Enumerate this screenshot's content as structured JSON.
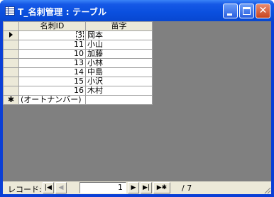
{
  "window": {
    "title": "T_名刺管理 : テーブル",
    "minimize_icon": "minimize-icon",
    "maximize_icon": "maximize-icon",
    "close_icon": "close-icon",
    "accent_color": "#0a4fde"
  },
  "table": {
    "columns": [
      "名刺ID",
      "苗字"
    ],
    "rows": [
      {
        "id": "3",
        "name": "岡本"
      },
      {
        "id": "11",
        "name": "小山"
      },
      {
        "id": "10",
        "name": "加藤"
      },
      {
        "id": "13",
        "name": "小林"
      },
      {
        "id": "14",
        "name": "中島"
      },
      {
        "id": "15",
        "name": "小沢"
      },
      {
        "id": "16",
        "name": "木村"
      }
    ],
    "new_row_marker": "✱",
    "new_row_placeholder": "(オートナンバー)",
    "current_row_marker_icon": "current-record-arrow-icon"
  },
  "navigation": {
    "label": "レコード:",
    "current_record": "1",
    "total_text": "/ 7",
    "first_icon": "first-record-icon",
    "prev_icon": "previous-record-icon",
    "next_icon": "next-record-icon",
    "last_icon": "last-record-icon",
    "new_icon": "new-record-icon"
  }
}
